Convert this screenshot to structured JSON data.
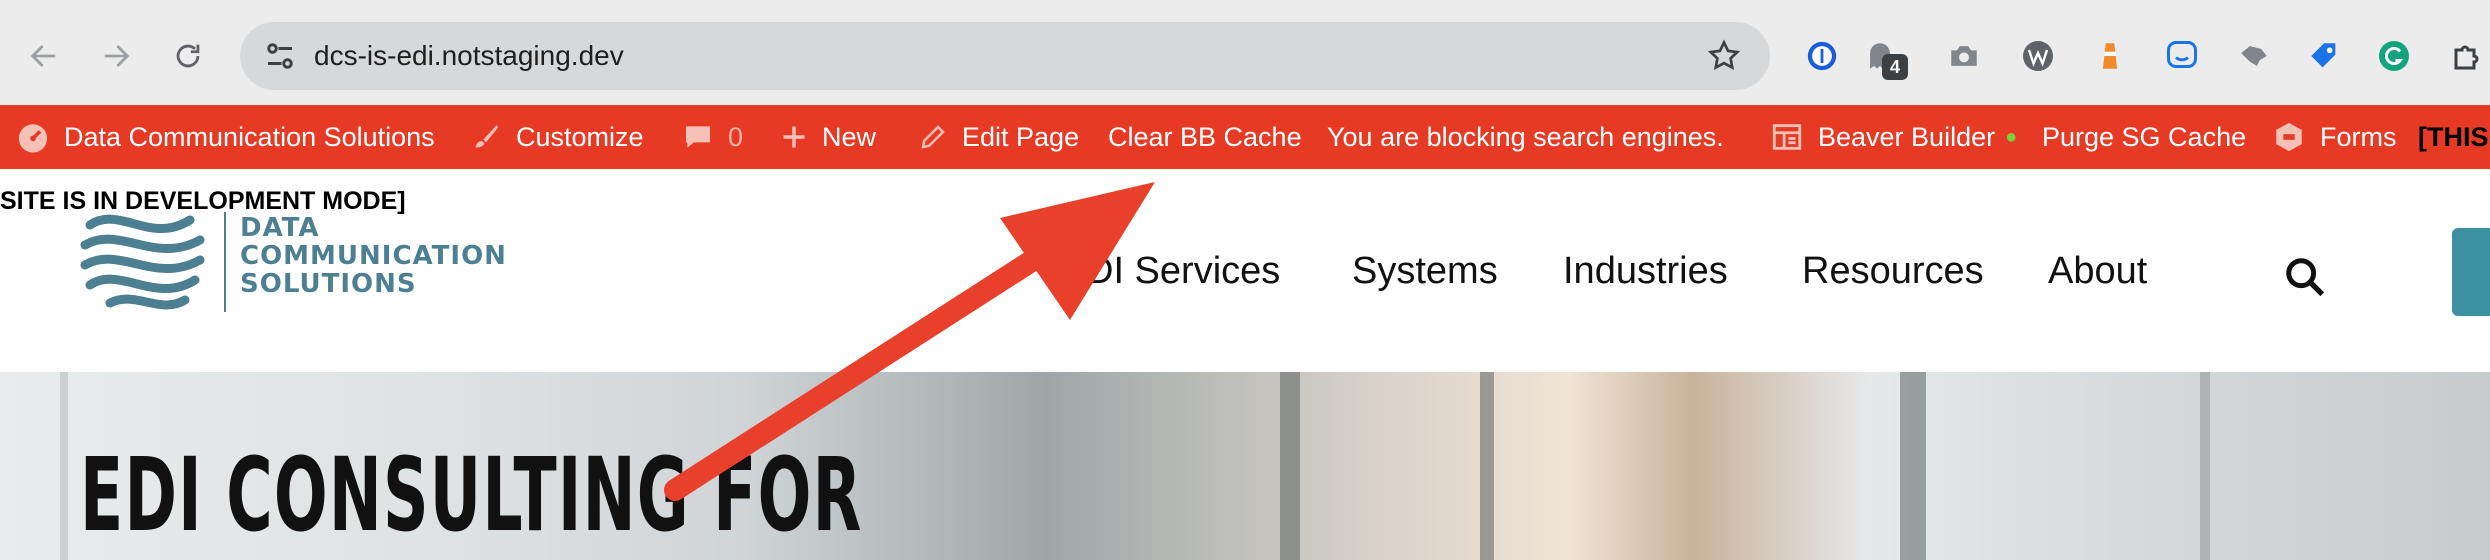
{
  "browser": {
    "url": "dcs-is-edi.notstaging.dev",
    "extension_badge": "4"
  },
  "admin_bar": {
    "site_name": "Data Communication Solutions",
    "customize": "Customize",
    "comments_count": "0",
    "new": "New",
    "edit_page": "Edit Page",
    "clear_cache": "Clear BB Cache",
    "blocking_notice": "You are blocking search engines.",
    "beaver_builder": "Beaver Builder",
    "purge_cache": "Purge SG Cache",
    "forms": "Forms",
    "dev_notice_start": "[THIS",
    "dev_notice_end": "SITE IS IN DEVELOPMENT MODE]"
  },
  "header": {
    "logo_lines": [
      "DATA",
      "COMMUNICATION",
      "SOLUTIONS"
    ],
    "nav": [
      "DI Services",
      "Systems",
      "Industries",
      "Resources",
      "About"
    ]
  },
  "hero": {
    "title": "EDI CONSULTING FOR"
  },
  "colors": {
    "admin_bar": "#e63a24",
    "brand": "#4b7f91",
    "arrow": "#e8402a"
  }
}
